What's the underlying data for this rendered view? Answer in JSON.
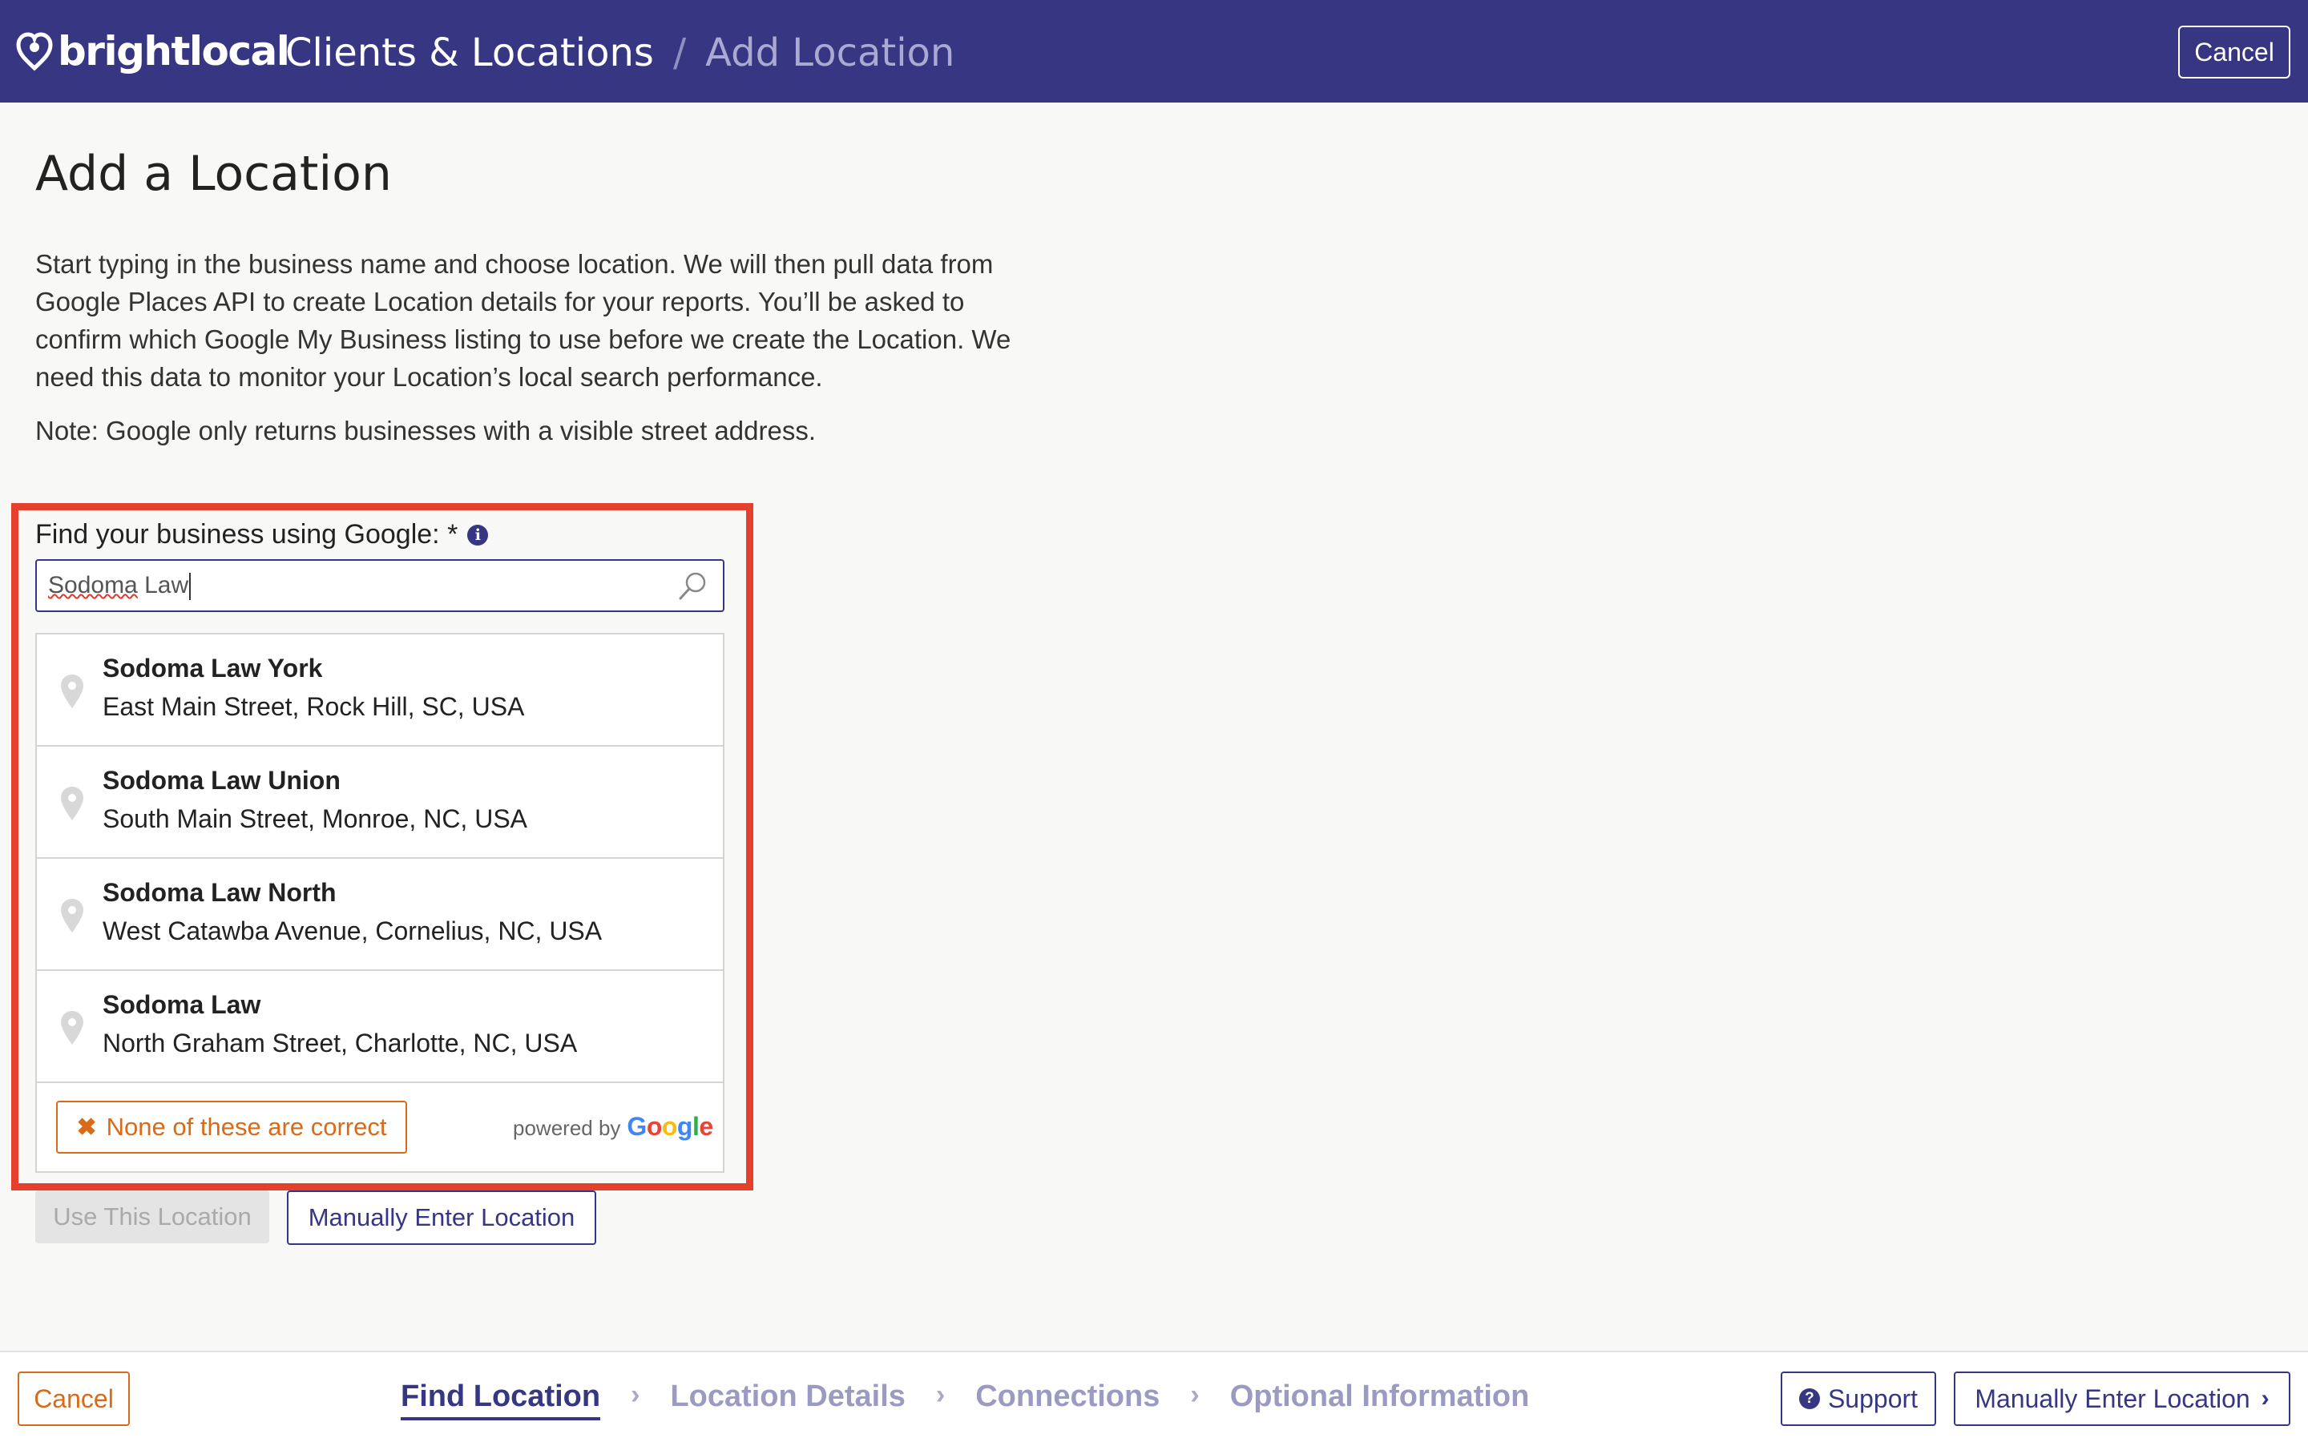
{
  "header": {
    "brand": "brightlocal",
    "breadcrumb_root": "Clients & Locations",
    "breadcrumb_separator": "/",
    "breadcrumb_current": "Add Location",
    "cancel_label": "Cancel",
    "bg_color": "#363683"
  },
  "main": {
    "title": "Add a Location",
    "intro": "Start typing in the business name and choose location. We will then pull data from Google Places API to create Location details for your reports. You’ll be asked to confirm which Google My Business listing to use before we create the Location. We need this data to monitor your Location’s local search performance.",
    "note": "Note: Google only returns businesses with a visible street address.",
    "search": {
      "label": "Find your business using Google: *",
      "value": "Sodoma Law",
      "value_part1": "Sodoma",
      "value_part2": " Law",
      "info_icon": "info-icon",
      "search_icon": "search-icon"
    },
    "suggestions": [
      {
        "name": "Sodoma Law York",
        "address": "East Main Street, Rock Hill, SC, USA"
      },
      {
        "name": "Sodoma Law Union",
        "address": "South Main Street, Monroe, NC, USA"
      },
      {
        "name": "Sodoma Law North",
        "address": "West Catawba Avenue, Cornelius, NC, USA"
      },
      {
        "name": "Sodoma Law",
        "address": "North Graham Street, Charlotte, NC, USA"
      }
    ],
    "none_correct_label": "None of these are correct",
    "powered_by": "powered by",
    "powered_brand_letters": [
      "G",
      "o",
      "o",
      "g",
      "l",
      "e"
    ],
    "use_location_label": "Use This Location",
    "manual_enter_label": "Manually Enter Location",
    "highlight_color": "#e5402b"
  },
  "footer": {
    "cancel_label": "Cancel",
    "steps": [
      {
        "label": "Find Location",
        "active": true
      },
      {
        "label": "Location Details",
        "active": false
      },
      {
        "label": "Connections",
        "active": false
      },
      {
        "label": "Optional Information",
        "active": false
      }
    ],
    "chevron": "›",
    "support_label": "Support",
    "support_icon_glyph": "?",
    "manual_enter_label": "Manually Enter Location",
    "manual_chevron": "›",
    "accent_color": "#363683",
    "cancel_color": "#d96b18"
  }
}
